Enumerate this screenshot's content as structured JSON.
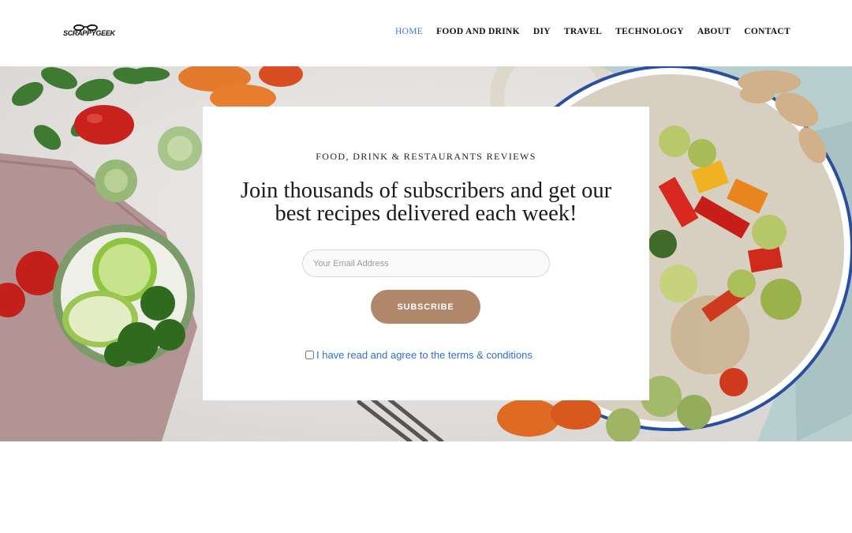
{
  "header": {
    "logo_text": "SCRAPPYGEEK",
    "nav": [
      {
        "label": "HOME",
        "active": true
      },
      {
        "label": "FOOD AND DRINK",
        "active": false
      },
      {
        "label": "DIY",
        "active": false
      },
      {
        "label": "TRAVEL",
        "active": false
      },
      {
        "label": "TECHNOLOGY",
        "active": false
      },
      {
        "label": "ABOUT",
        "active": false
      },
      {
        "label": "CONTACT",
        "active": false
      }
    ]
  },
  "signup": {
    "eyebrow": "FOOD, DRINK & RESTAURANTS REVIEWS",
    "headline": "Join thousands of subscribers and get our best recipes delivered each week!",
    "email_placeholder": "Your Email Address",
    "email_value": "",
    "subscribe_label": "SUBSCRIBE",
    "terms_label": "I have read and agree to the terms & conditions",
    "terms_checked": false
  },
  "colors": {
    "nav_active": "#3a7bd5",
    "subscribe_button": "#b0876a",
    "terms_link": "#2f6fd1"
  }
}
